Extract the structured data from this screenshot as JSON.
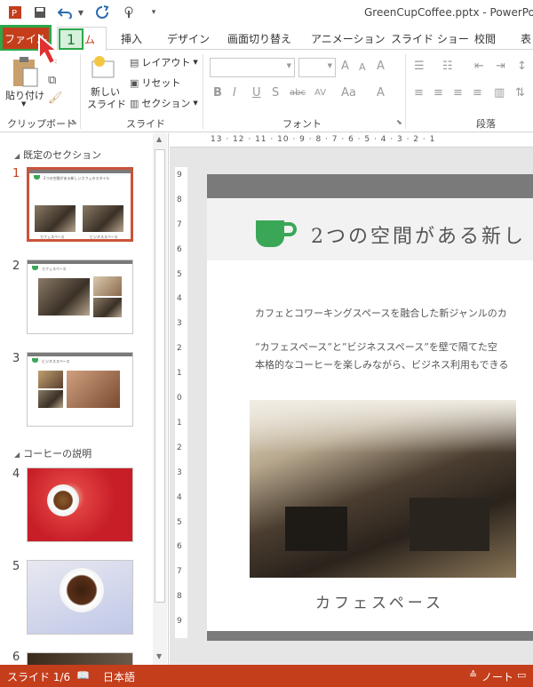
{
  "window": {
    "title": "GreenCupCoffee.pptx - PowerPoi"
  },
  "qat": {
    "icons": [
      "powerpoint-logo-icon",
      "save-icon",
      "undo-icon",
      "redo-icon",
      "touch-mode-icon",
      "customize-qat-icon"
    ]
  },
  "tabs": {
    "file": "ファイル",
    "home": "ム",
    "insert": "挿入",
    "design": "デザイン",
    "transitions": "画面切り替え",
    "animations": "アニメーション",
    "slideshow": "スライド ショー",
    "review": "校閲",
    "view": "表"
  },
  "step_badge": "1",
  "ribbon": {
    "clipboard": {
      "paste": "貼り付け",
      "label": "クリップボード"
    },
    "slides": {
      "new_slide_line1": "新しい",
      "new_slide_line2": "スライド",
      "layout": "レイアウト",
      "reset": "リセット",
      "section": "セクション",
      "label": "スライド"
    },
    "font": {
      "bold": "B",
      "italic": "I",
      "underline": "U",
      "shadow": "S",
      "strike": "abc",
      "spacing": "AV",
      "case": "Aa",
      "grow": "A",
      "shrink": "A",
      "clear": "A",
      "color": "A",
      "label": "フォント"
    },
    "paragraph": {
      "label": "段落"
    }
  },
  "thumbnails": {
    "section1": "既定のセクション",
    "section2": "コーヒーの説明",
    "slides": [
      {
        "number": "1",
        "title": "2つの空間がある新しいカフェのスタイル",
        "cap1": "カフェスペース",
        "cap2": "ビジネススペース"
      },
      {
        "number": "2",
        "title": "カフェスペース"
      },
      {
        "number": "3",
        "title": "ビジネススペース"
      },
      {
        "number": "4"
      },
      {
        "number": "5"
      },
      {
        "number": "6"
      }
    ]
  },
  "ruler": {
    "h": "13 · 12 · 11 · 10 · 9 · 8 · 7 · 6 · 5 · 4 · 3 · 2 · 1",
    "v": [
      "9",
      "8",
      "7",
      "6",
      "5",
      "4",
      "3",
      "2",
      "1",
      "0",
      "1",
      "2",
      "3",
      "4",
      "5",
      "6",
      "7",
      "8",
      "9"
    ]
  },
  "slide": {
    "title": "2つの空間がある新し",
    "line1": "カフェとコワーキングスペースを融合した新ジャンルのカ",
    "line2": "“カフェスペース“と”ビジネススペース”を壁で隔てた空",
    "line3": "本格的なコーヒーを楽しみながら、ビジネス利用もできる",
    "caption": "カフェスペース"
  },
  "status": {
    "slide": "スライド 1/6",
    "language": "日本語",
    "notes": "ノート"
  },
  "colors": {
    "accent": "#c43e1c",
    "highlight": "#2aa84a",
    "cup": "#3aa757"
  }
}
